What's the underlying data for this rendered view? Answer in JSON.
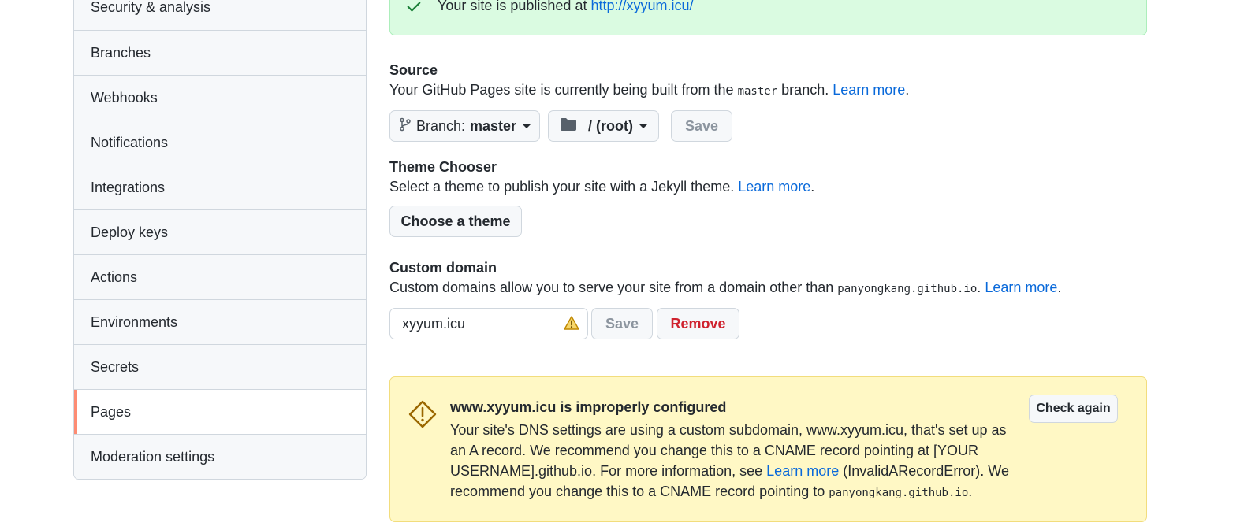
{
  "sidebar": {
    "items": [
      {
        "label": "Security & analysis"
      },
      {
        "label": "Branches"
      },
      {
        "label": "Webhooks"
      },
      {
        "label": "Notifications"
      },
      {
        "label": "Integrations"
      },
      {
        "label": "Deploy keys"
      },
      {
        "label": "Actions"
      },
      {
        "label": "Environments"
      },
      {
        "label": "Secrets"
      },
      {
        "label": "Pages"
      },
      {
        "label": "Moderation settings"
      }
    ],
    "selected": "Pages"
  },
  "published_flash": {
    "text": "Your site is published at",
    "url": "http://xyyum.icu/"
  },
  "source": {
    "heading": "Source",
    "desc_before": "Your GitHub Pages site is currently being built from the",
    "desc_branch_code": "master",
    "desc_after": "branch.",
    "learn_more": "Learn more",
    "branch_prefix": "Branch:",
    "branch_value": "master",
    "folder_value": "/ (root)",
    "save_label": "Save"
  },
  "theme": {
    "heading": "Theme Chooser",
    "desc": "Select a theme to publish your site with a Jekyll theme.",
    "learn_more": "Learn more",
    "button_label": "Choose a theme"
  },
  "custom_domain": {
    "heading": "Custom domain",
    "desc_before": "Custom domains allow you to serve your site from a domain other than",
    "desc_domain_code": "panyongkang.github.io",
    "learn_more": "Learn more",
    "input_value": "xyyum.icu",
    "save_label": "Save",
    "remove_label": "Remove"
  },
  "dns_warning": {
    "title": "www.xyyum.icu is improperly configured",
    "body_before": "Your site's DNS settings are using a custom subdomain, www.xyyum.icu, that's set up as an A record. We recommend you change this to a CNAME record pointing at [YOUR USERNAME].github.io. For more information, see",
    "learn_more": "Learn more",
    "body_middle": "(InvalidARecordError). We recommend you change this to a CNAME record pointing to",
    "body_code": "panyongkang.github.io",
    "check_again_label": "Check again"
  },
  "colors": {
    "success_bg": "#dafbe1",
    "warning_bg": "#fff8c5",
    "link": "#0969da",
    "danger": "#cf222e",
    "selected_accent": "#fd8c73"
  }
}
